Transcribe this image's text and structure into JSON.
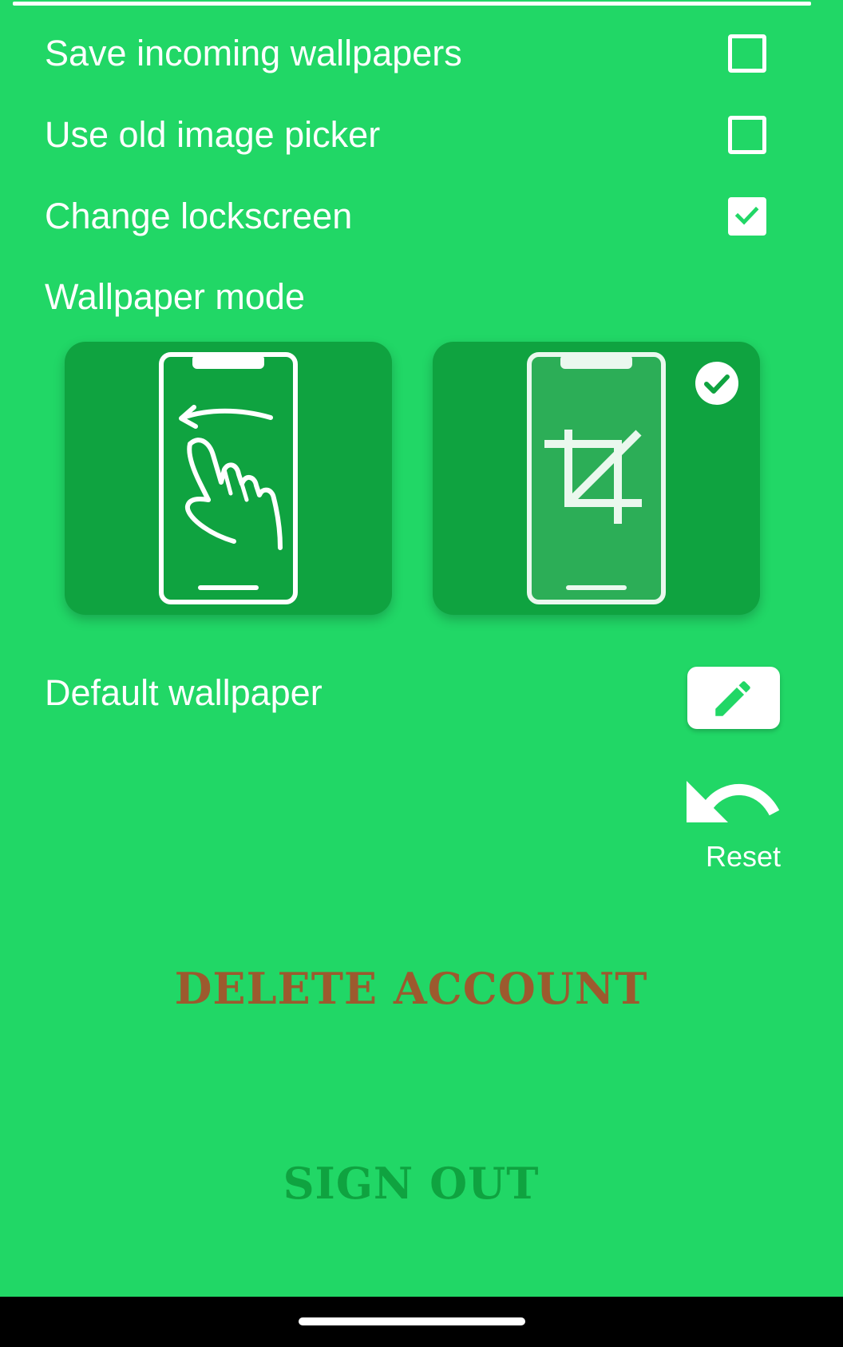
{
  "settings": {
    "save_incoming_wallpapers": {
      "label": "Save incoming wallpapers",
      "checked": false
    },
    "use_old_image_picker": {
      "label": "Use old image picker",
      "checked": false
    },
    "change_lockscreen": {
      "label": "Change lockscreen",
      "checked": true
    }
  },
  "wallpaper_mode": {
    "label": "Wallpaper mode",
    "options": [
      {
        "name": "scrolling",
        "icon": "phone-swipe-hand-icon",
        "selected": false
      },
      {
        "name": "cropped",
        "icon": "phone-crop-icon",
        "selected": true
      }
    ]
  },
  "default_wallpaper": {
    "label": "Default wallpaper",
    "edit_icon": "pencil-icon",
    "reset_icon": "undo-arrow-icon",
    "reset_label": "Reset"
  },
  "actions": {
    "delete_account": "DELETE ACCOUNT",
    "sign_out": "SIGN OUT"
  },
  "colors": {
    "background": "#21d766",
    "card": "#0fa340",
    "delete_text": "#9c5a2e",
    "sign_out_text": "#0fa340",
    "white": "#ffffff"
  }
}
